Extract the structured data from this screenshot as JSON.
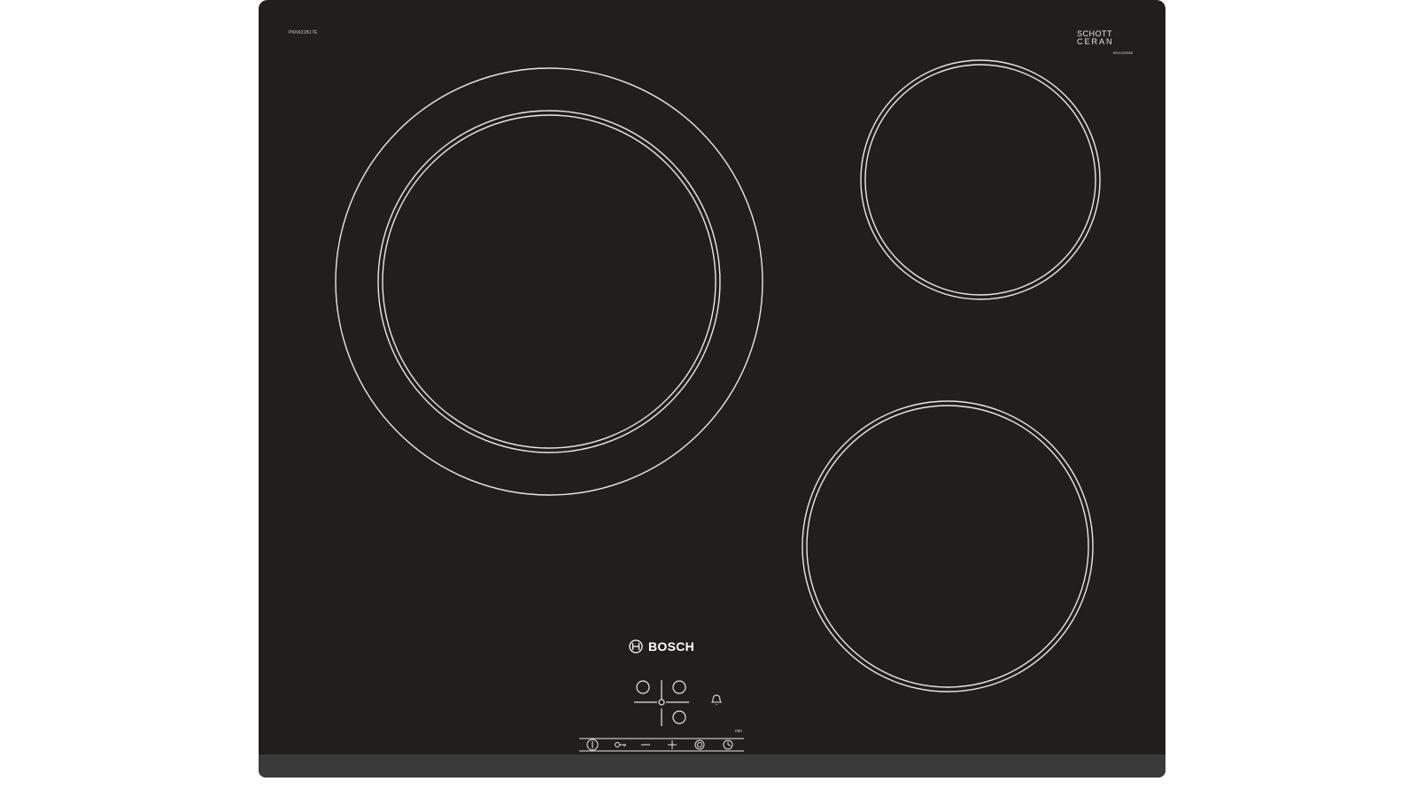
{
  "hob": {
    "model_code": "PKK631B17E",
    "schott_logo_line1": "SCHOTT",
    "schott_logo_line2": "CERAN",
    "schott_code": "8001043838",
    "brand_name": "BOSCH",
    "min_label": "min"
  },
  "colors": {
    "glass": "#201f1d",
    "edge": "#3a3a3a",
    "markings": "#e8e8e8"
  },
  "icons": {
    "brand_logo": "bosch-armature-icon",
    "timer_alarm": "bell-icon",
    "power": "power-icon",
    "childlock": "key-icon",
    "minus": "minus-icon",
    "plus": "plus-icon",
    "dual_zone": "dual-ring-icon",
    "timer": "clock-icon"
  }
}
